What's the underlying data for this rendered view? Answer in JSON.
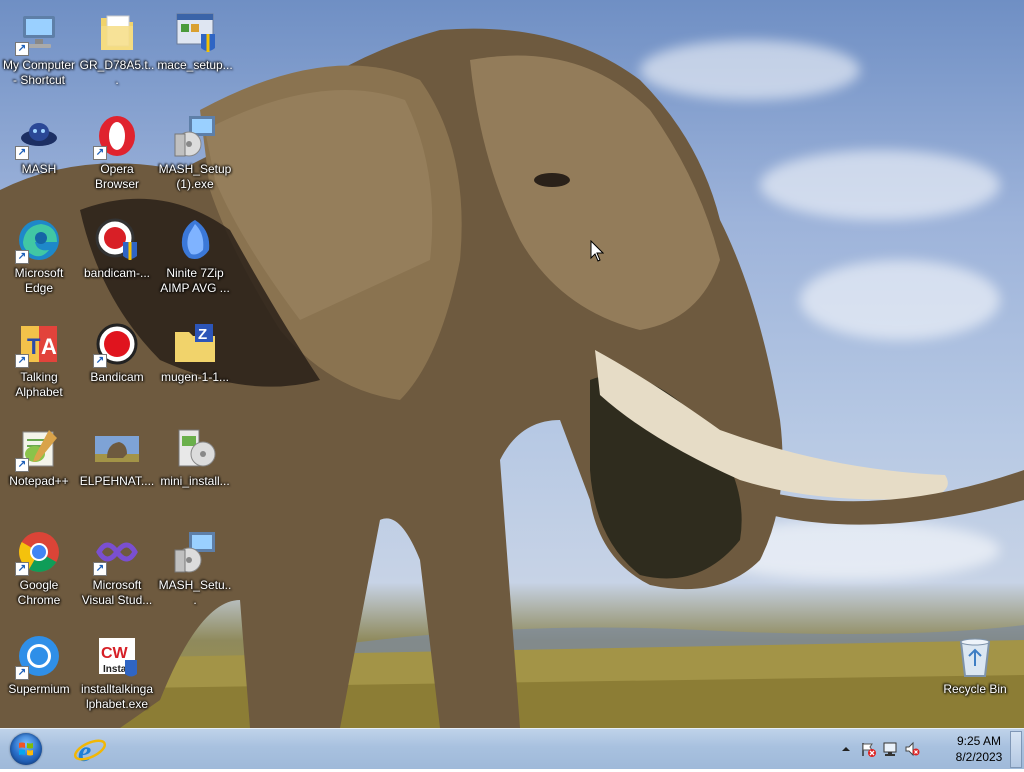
{
  "desktop": {
    "icons": [
      {
        "label": "My Computer - Shortcut",
        "icon": "computer-icon"
      },
      {
        "label": "GR_D78A5.t...",
        "icon": "folder-icon"
      },
      {
        "label": "mace_setup...",
        "icon": "installer-icon"
      },
      {
        "label": "MASH",
        "icon": "mash-icon"
      },
      {
        "label": "Opera Browser",
        "icon": "opera-icon"
      },
      {
        "label": "MASH_Setup (1).exe",
        "icon": "setup-icon"
      },
      {
        "label": "Microsoft Edge",
        "icon": "edge-icon"
      },
      {
        "label": "bandicam-...",
        "icon": "bandicam-installer-icon"
      },
      {
        "label": "Ninite 7Zip AIMP AVG ...",
        "icon": "ninite-icon"
      },
      {
        "label": "Talking Alphabet",
        "icon": "talking-alphabet-icon"
      },
      {
        "label": "Bandicam",
        "icon": "bandicam-icon"
      },
      {
        "label": "mugen-1-1...",
        "icon": "zip-folder-icon"
      },
      {
        "label": "Notepad++",
        "icon": "notepadpp-icon"
      },
      {
        "label": "ELPEHNAT....",
        "icon": "image-file-icon"
      },
      {
        "label": "mini_install...",
        "icon": "mini-installer-icon"
      },
      {
        "label": "Google Chrome",
        "icon": "chrome-icon"
      },
      {
        "label": "Microsoft Visual Stud...",
        "icon": "visual-studio-icon"
      },
      {
        "label": "MASH_Setu...",
        "icon": "setup-icon"
      },
      {
        "label": "Supermium",
        "icon": "supermium-icon"
      },
      {
        "label": "installtalkinga lphabet.exe",
        "icon": "installer-exe-icon"
      },
      {
        "label": "Recycle Bin",
        "icon": "recycle-bin-icon"
      }
    ]
  },
  "taskbar": {
    "start_label": "Start",
    "pinned": [
      {
        "name": "Internet Explorer",
        "icon": "ie-icon"
      }
    ],
    "tray": {
      "icons": [
        "show-hidden-icons-chevron-icon",
        "action-center-flag-icon",
        "network-icon",
        "volume-muted-icon"
      ],
      "time": "9:25 AM",
      "date": "8/2/2023"
    }
  },
  "colors": {
    "taskbar_top": "#bfd3ea",
    "taskbar_bottom": "#9fb9d9",
    "label_text": "#ffffff"
  }
}
